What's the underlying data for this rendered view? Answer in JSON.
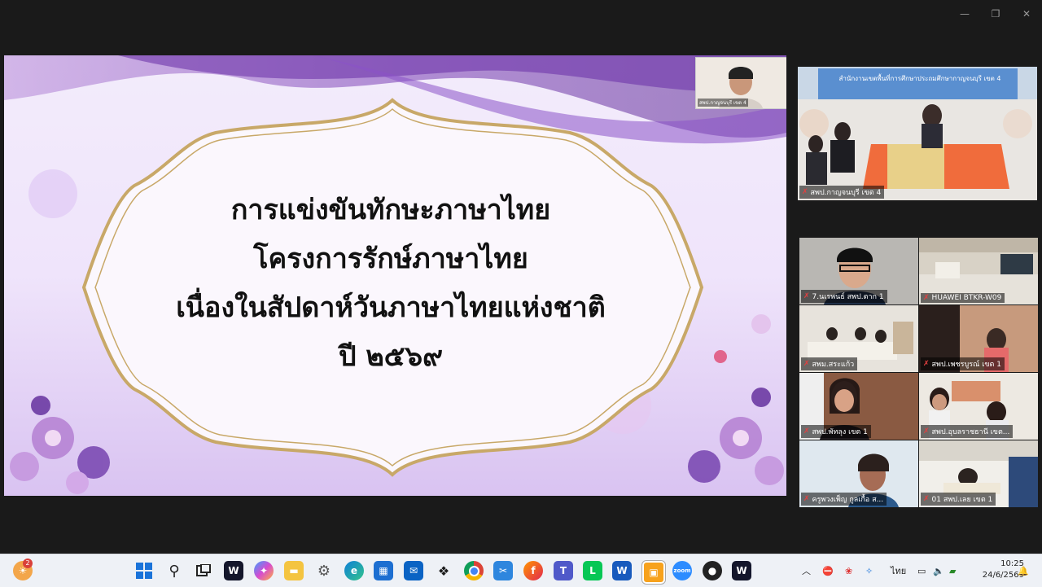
{
  "window": {
    "minimize": "—",
    "restore": "❐",
    "close": "✕"
  },
  "slide": {
    "title_lines": [
      "การแข่งขันทักษะภาษาไทย",
      "โครงการรักษ์ภาษาไทย",
      "เนื่องในสัปดาห์วันภาษาไทยแห่งชาติ",
      "ปี ๒๕๖๙"
    ],
    "presenter_label": "สพป.กาญจนบุรี เขต 4"
  },
  "participants": {
    "main": {
      "label": "สพป.กาญจนบุรี เขต 4",
      "banner": "สำนักงานเขตพื้นที่การศึกษาประถมศึกษากาญจนบุรี เขต 4"
    },
    "tiles": [
      {
        "label": "7.นเรพนธ์ สพป.ตาก 1"
      },
      {
        "label": "HUAWEI BTKR-W09"
      },
      {
        "label": "สพม.สระแก้ว"
      },
      {
        "label": "สพป.เพชรบูรณ์ เขต 1"
      },
      {
        "label": "สพป.พัทลุง เขต 1"
      },
      {
        "label": "สพป.อุบลราชธานี เขต..."
      },
      {
        "label": "ครูพวงเพ็ญ กูลเกื้อ ส..."
      },
      {
        "label": "01 สพป.เลย เขต 1"
      }
    ]
  },
  "taskbar": {
    "notification_count": "2",
    "apps": [
      "widgets-icon",
      "start-icon",
      "search-icon",
      "task-view-icon",
      "webex-icon",
      "copilot-icon",
      "file-explorer-icon",
      "settings-icon",
      "edge-icon",
      "store-icon",
      "outlook-icon",
      "dropbox-icon",
      "chrome-icon",
      "snipping-icon",
      "firefox-icon",
      "teams-icon",
      "line-icon",
      "word-icon",
      "presentation-app-icon",
      "zoom-icon",
      "recorder-icon",
      "webex-meetings-icon"
    ],
    "language": "ไทย",
    "time": "10:25",
    "date": "24/6/2569"
  },
  "colors": {
    "accent_purple": "#8c4fc4",
    "frame_gold": "#c8a868",
    "taskbar_bg": "#eef1f6"
  }
}
